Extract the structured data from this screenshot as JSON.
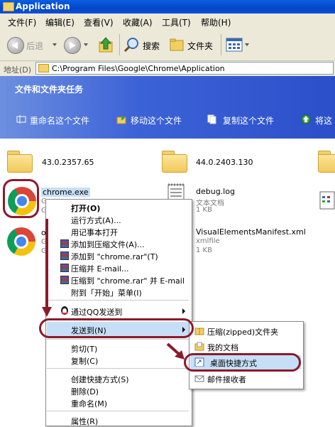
{
  "window": {
    "title": "Application"
  },
  "menubar": {
    "items": [
      "文件(F)",
      "编辑(E)",
      "查看(V)",
      "收藏(A)",
      "工具(T)",
      "帮助(H)"
    ]
  },
  "toolbar": {
    "back_label": "后退",
    "search_label": "搜索",
    "folders_label": "文件夹"
  },
  "address": {
    "label": "地址(D)",
    "value": "C:\\Program Files\\Google\\Chrome\\Application"
  },
  "task_pane": {
    "header": "文件和文件夹任务",
    "tasks": [
      "重命名这个文件",
      "移动这个文件",
      "复制这个文件",
      "将这"
    ]
  },
  "files": {
    "folder1": {
      "name": "43.0.2357.65"
    },
    "folder2": {
      "name": "44.0.2403.130"
    },
    "chrome_exe": {
      "name": "chrome.exe",
      "line2": "Goo",
      "line3": "Goo"
    },
    "old_chrome": {
      "name": "old_",
      "line2": "Goo",
      "line3": "Goo"
    },
    "debug_log": {
      "name": "debug.log",
      "type": "文本文档",
      "size": "1 KB"
    },
    "manifest": {
      "name": "VisualElementsManifest.xml",
      "type": "xmlfile",
      "size": "1 KB"
    }
  },
  "context_menu": {
    "open": "打开(O)",
    "run_as": "运行方式(A)...",
    "open_notepad": "用记事本打开",
    "add_archive": "添加到压缩文件(A)...",
    "add_rar": "添加到 \"chrome.rar\"(T)",
    "compress_email": "压缩并 E-mail...",
    "compress_rar_email": "压缩到 \"chrome.rar\" 并 E-mail",
    "pin_start": "附到「开始」菜单(I)",
    "send_qq": "通过QQ发送到",
    "send_to": "发送到(N)",
    "cut": "剪切(T)",
    "copy": "复制(C)",
    "create_shortcut": "创建快捷方式(S)",
    "delete": "删除(D)",
    "rename": "重命名(M)",
    "properties": "属性(R)"
  },
  "submenu": {
    "zip": "压缩(zipped)文件夹",
    "my_docs": "我的文档",
    "desktop_shortcut": "桌面快捷方式",
    "mail_recipient": "邮件接收者"
  },
  "colors": {
    "task_pane": "#3d63d8",
    "highlight": "#c7dff6",
    "annotation": "#8b1a2b"
  }
}
